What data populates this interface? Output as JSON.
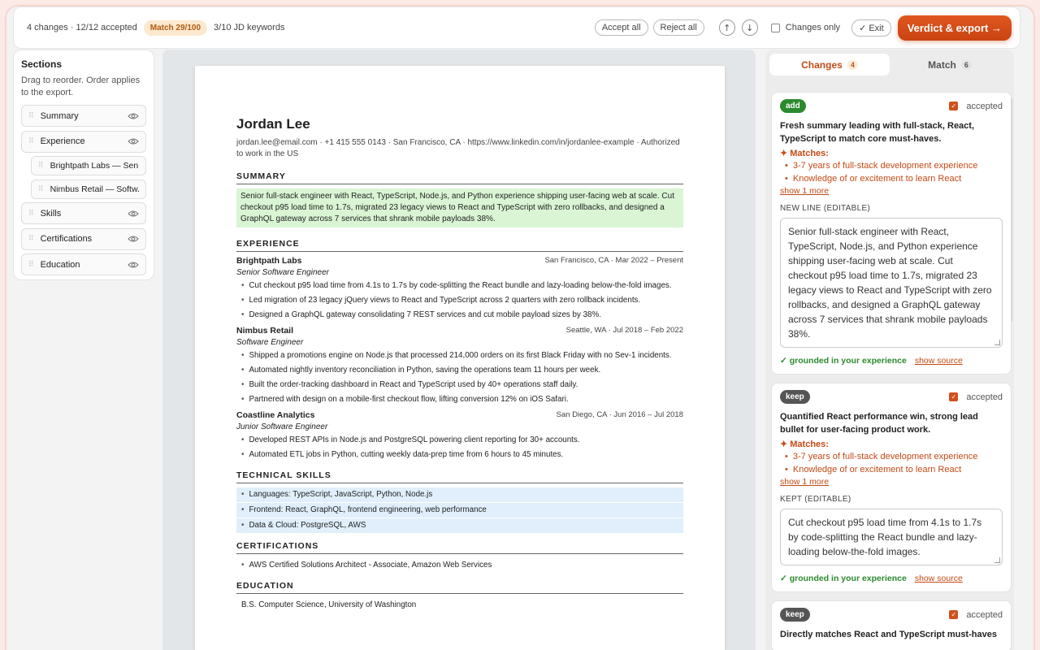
{
  "toolbar": {
    "changes_stat": "4 changes · 12/12 accepted",
    "match_badge": "Match 29/100",
    "jd_keywords": "3/10 JD keywords",
    "accept_all": "Accept all",
    "reject_all": "Reject all",
    "prev_icon": "arrow-up-icon",
    "prev_glyph": "↑",
    "next_icon": "arrow-down-icon",
    "next_glyph": "↓",
    "changes_only": "Changes only",
    "exit": "✓ Exit",
    "export": "Verdict & export →"
  },
  "sidebar": {
    "title": "Sections",
    "hint": "Drag to reorder. Order applies to the export.",
    "items": [
      {
        "label": "Summary"
      },
      {
        "label": "Experience"
      },
      {
        "label": "Brightpath Labs — Sen..."
      },
      {
        "label": "Nimbus Retail — Softw..."
      },
      {
        "label": "Skills"
      },
      {
        "label": "Certifications"
      },
      {
        "label": "Education"
      }
    ]
  },
  "resume": {
    "name": "Jordan Lee",
    "contact": "jordan.lee@email.com · +1 415 555 0143 · San Francisco, CA · https://www.linkedin.com/in/jordanlee-example · Authorized to work in the US",
    "summary_h": "SUMMARY",
    "summary": "Senior full-stack engineer with React, TypeScript, Node.js, and Python experience shipping user-facing web at scale. Cut checkout p95 load time to 1.7s, migrated 23 legacy views to React and TypeScript with zero rollbacks, and designed a GraphQL gateway across 7 services that shrank mobile payloads 38%.",
    "experience_h": "EXPERIENCE",
    "jobs": [
      {
        "company": "Brightpath Labs",
        "meta": "San Francisco, CA · Mar 2022 – Present",
        "role": "Senior Software Engineer",
        "bullets": [
          "Cut checkout p95 load time from 4.1s to 1.7s by code-splitting the React bundle and lazy-loading below-the-fold images.",
          "Led migration of 23 legacy jQuery views to React and TypeScript across 2 quarters with zero rollback incidents.",
          "Designed a GraphQL gateway consolidating 7 REST services and cut mobile payload sizes by 38%."
        ]
      },
      {
        "company": "Nimbus Retail",
        "meta": "Seattle, WA · Jul 2018 – Feb 2022",
        "role": "Software Engineer",
        "bullets": [
          "Shipped a promotions engine on Node.js that processed 214,000 orders on its first Black Friday with no Sev-1 incidents.",
          "Automated nightly inventory reconciliation in Python, saving the operations team 11 hours per week.",
          "Built the order-tracking dashboard in React and TypeScript used by 40+ operations staff daily.",
          "Partnered with design on a mobile-first checkout flow, lifting conversion 12% on iOS Safari."
        ]
      },
      {
        "company": "Coastline Analytics",
        "meta": "San Diego, CA · Jun 2016 – Jul 2018",
        "role": "Junior Software Engineer",
        "bullets": [
          "Developed REST APIs in Node.js and PostgreSQL powering client reporting for 30+ accounts.",
          "Automated ETL jobs in Python, cutting weekly data-prep time from 6 hours to 45 minutes."
        ]
      }
    ],
    "skills_h": "TECHNICAL SKILLS",
    "skills": [
      "Languages: TypeScript, JavaScript, Python, Node.js",
      "Frontend: React, GraphQL, frontend engineering, web performance",
      "Data & Cloud: PostgreSQL, AWS"
    ],
    "certs_h": "CERTIFICATIONS",
    "certs": [
      "AWS Certified Solutions Architect - Associate, Amazon Web Services"
    ],
    "edu_h": "EDUCATION",
    "edu": "B.S. Computer Science, University of Washington"
  },
  "panel": {
    "tabs": [
      {
        "label": "Changes",
        "count": "4"
      },
      {
        "label": "Match",
        "count": "6"
      }
    ],
    "cards": [
      {
        "tag": "add",
        "accepted": "accepted",
        "title": "Fresh summary leading with full-stack, React, TypeScript to match core must-haves.",
        "matches_h": "✦ Matches:",
        "matches": [
          "3-7 years of full-stack development experience",
          "Knowledge of or excitement to learn React"
        ],
        "show_more": "show 1 more",
        "field_label": "NEW LINE (EDITABLE)",
        "text": "Senior full-stack engineer with React, TypeScript, Node.js, and Python experience shipping user-facing web at scale. Cut checkout p95 load time to 1.7s, migrated 23 legacy views to React and TypeScript with zero rollbacks, and designed a GraphQL gateway across 7 services that shrank mobile payloads 38%.",
        "grounded": "✓ grounded in your experience",
        "show_source": "show source"
      },
      {
        "tag": "keep",
        "accepted": "accepted",
        "title": "Quantified React performance win, strong lead bullet for user-facing product work.",
        "matches_h": "✦ Matches:",
        "matches": [
          "3-7 years of full-stack development experience",
          "Knowledge of or excitement to learn React"
        ],
        "show_more": "show 1 more",
        "field_label": "KEPT (EDITABLE)",
        "text": "Cut checkout p95 load time from 4.1s to 1.7s by code-splitting the React bundle and lazy-loading below-the-fold images.",
        "grounded": "✓ grounded in your experience",
        "show_source": "show source"
      },
      {
        "tag": "keep",
        "accepted": "accepted",
        "title": "Directly matches React and TypeScript must-haves"
      }
    ]
  },
  "colors": {
    "accent": "#c44a16",
    "add": "#2b8a2e",
    "keep": "#555555",
    "summary_hl": "#d9f5d3",
    "skills_hl": "#e0effb"
  }
}
